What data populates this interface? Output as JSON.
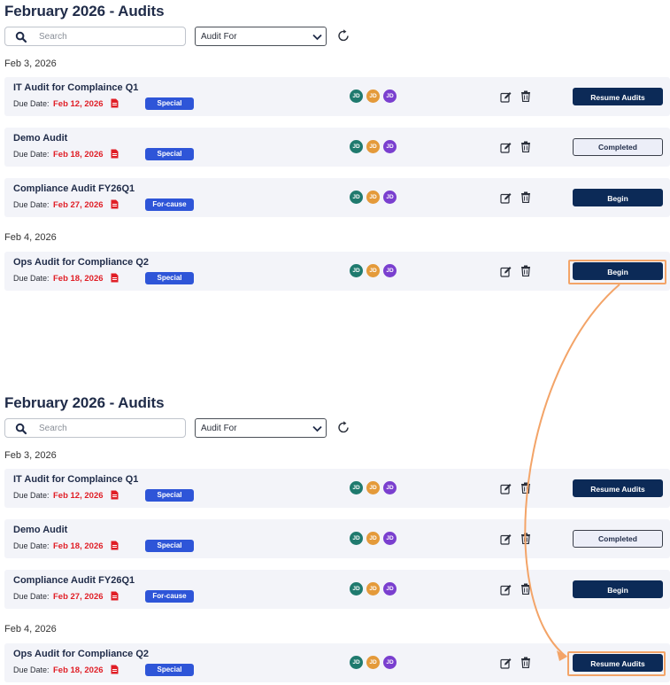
{
  "panels": [
    {
      "title": "February 2026 - Audits",
      "search": {
        "placeholder": "Search"
      },
      "filter": {
        "selected": "Audit For"
      },
      "groups": [
        {
          "date": "Feb 3, 2026",
          "rows": [
            {
              "name": "IT Audit for Complaince Q1",
              "due_label": "Due Date:",
              "due": "Feb 12, 2026",
              "tag": "Special",
              "avatars": [
                "JD",
                "JD",
                "JD"
              ],
              "action": "Resume Audits",
              "action_style": "dark"
            },
            {
              "name": "Demo Audit",
              "due_label": "Due Date:",
              "due": "Feb 18, 2026",
              "tag": "Special",
              "avatars": [
                "JD",
                "JD",
                "JD"
              ],
              "action": "Completed",
              "action_style": "light"
            },
            {
              "name": "Compliance Audit FY26Q1",
              "due_label": "Due Date:",
              "due": "Feb 27, 2026",
              "tag": "For-cause",
              "avatars": [
                "JD",
                "JD",
                "JD"
              ],
              "action": "Begin",
              "action_style": "dark"
            }
          ]
        },
        {
          "date": "Feb 4, 2026",
          "rows": [
            {
              "name": "Ops Audit for Compliance Q2",
              "due_label": "Due Date:",
              "due": "Feb 18, 2026",
              "tag": "Special",
              "avatars": [
                "JD",
                "JD",
                "JD"
              ],
              "action": "Begin",
              "action_style": "dark"
            }
          ]
        }
      ]
    },
    {
      "title": "February 2026 - Audits",
      "search": {
        "placeholder": "Search"
      },
      "filter": {
        "selected": "Audit For"
      },
      "groups": [
        {
          "date": "Feb 3, 2026",
          "rows": [
            {
              "name": "IT Audit for Complaince Q1",
              "due_label": "Due Date:",
              "due": "Feb 12, 2026",
              "tag": "Special",
              "avatars": [
                "JD",
                "JD",
                "JD"
              ],
              "action": "Resume Audits",
              "action_style": "dark"
            },
            {
              "name": "Demo Audit",
              "due_label": "Due Date:",
              "due": "Feb 18, 2026",
              "tag": "Special",
              "avatars": [
                "JD",
                "JD",
                "JD"
              ],
              "action": "Completed",
              "action_style": "light"
            },
            {
              "name": "Compliance Audit FY26Q1",
              "due_label": "Due Date:",
              "due": "Feb 27, 2026",
              "tag": "For-cause",
              "avatars": [
                "JD",
                "JD",
                "JD"
              ],
              "action": "Begin",
              "action_style": "dark"
            }
          ]
        },
        {
          "date": "Feb 4, 2026",
          "rows": [
            {
              "name": "Ops Audit for Compliance Q2",
              "due_label": "Due Date:",
              "due": "Feb 18, 2026",
              "tag": "Special",
              "avatars": [
                "JD",
                "JD",
                "JD"
              ],
              "action": "Resume Audits",
              "action_style": "dark"
            }
          ]
        }
      ]
    }
  ],
  "colors": {
    "avatars": [
      "#1f7a6e",
      "#e49a3a",
      "#7a3fcf"
    ],
    "due_date": "#e01e26",
    "tag": "#2e55d8",
    "button_dark": "#0c2a57",
    "highlight": "#f3a468"
  },
  "icons": {
    "search": "search-icon",
    "dropdown": "chevron-down-icon",
    "refresh": "refresh-icon",
    "file": "pdf-file-icon",
    "edit": "edit-icon",
    "delete": "trash-icon",
    "arrow": "curved-arrow-icon"
  }
}
